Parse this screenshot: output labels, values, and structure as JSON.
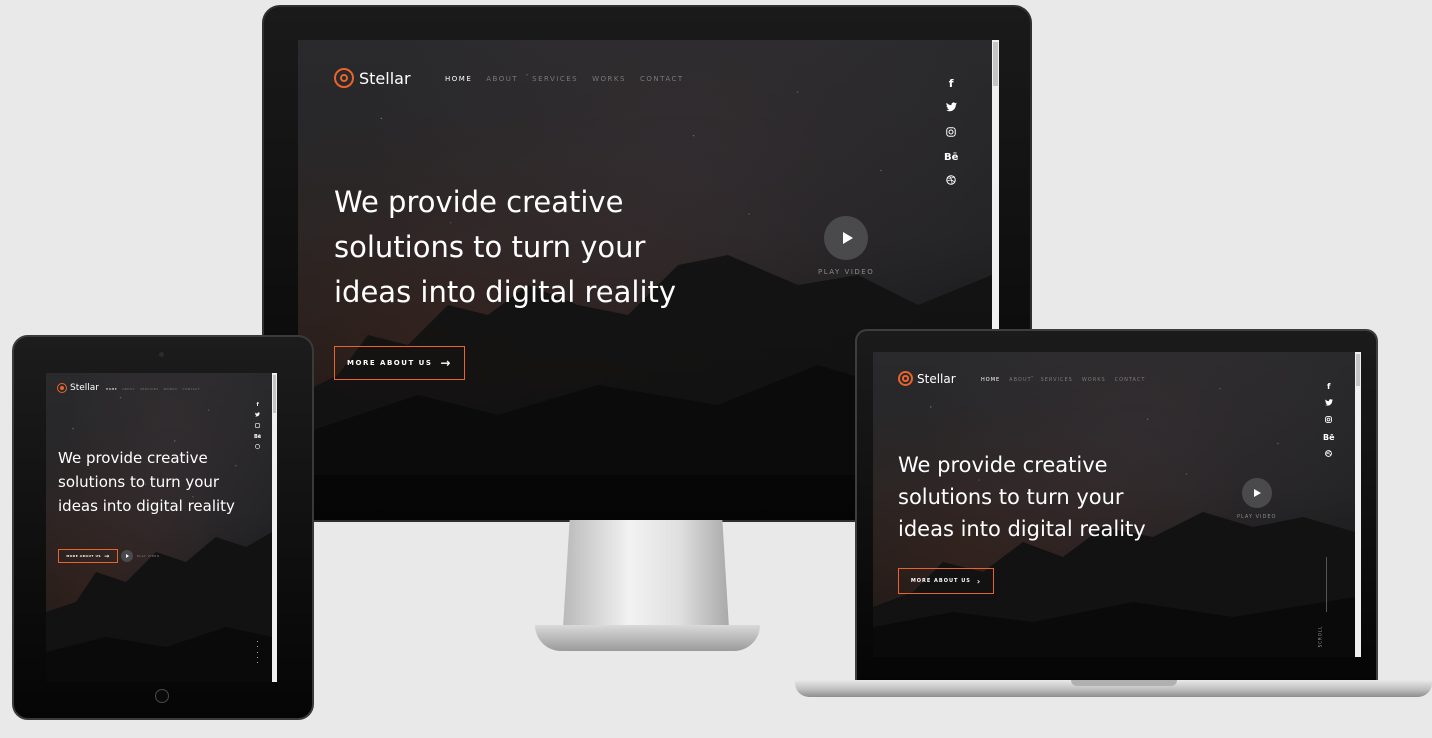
{
  "site": {
    "brand": "Stellar",
    "nav": [
      "Home",
      "About",
      "Services",
      "Works",
      "Contact"
    ],
    "headline": [
      "We provide creative",
      "solutions to turn your",
      "ideas into digital reality"
    ],
    "cta_label": "More About Us",
    "cta_arrow": "→",
    "play_label": "PLAY VIDEO",
    "scroll_label": "SCROLL",
    "social": [
      {
        "icon": "facebook-icon",
        "glyph": "f"
      },
      {
        "icon": "twitter-icon",
        "glyph": "🐦"
      },
      {
        "icon": "instagram-icon",
        "glyph": "◎"
      },
      {
        "icon": "behance-icon",
        "glyph": "Bē"
      },
      {
        "icon": "dribbble-icon",
        "glyph": "⊛"
      }
    ]
  },
  "colors": {
    "accent": "#e8642c",
    "background": "#1c1c1e",
    "nav_inactive": "#7a7a7a"
  }
}
